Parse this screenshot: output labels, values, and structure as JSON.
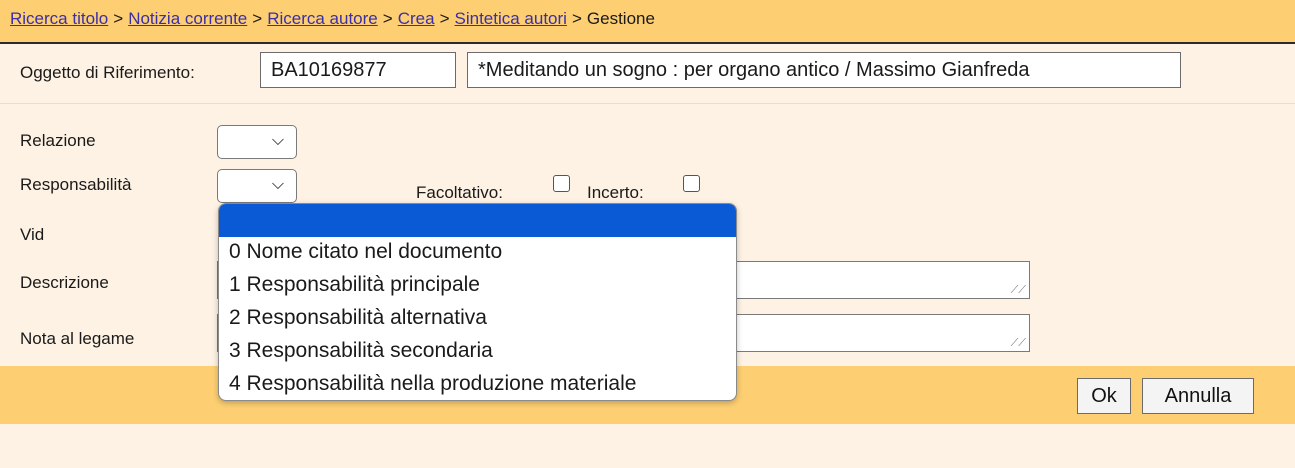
{
  "breadcrumb": {
    "links": [
      "Ricerca titolo",
      "Notizia corrente",
      "Ricerca autore",
      "Crea",
      "Sintetica autori"
    ],
    "separator": ">",
    "current": "Gestione"
  },
  "reference": {
    "label": "Oggetto di Riferimento:",
    "id_value": "BA10169877",
    "title_value": "*Meditando un sogno : per organo antico / Massimo Gianfreda"
  },
  "form": {
    "relazione_label": "Relazione",
    "responsabilita_label": "Responsabilità",
    "vid_label": "Vid",
    "descrizione_label": "Descrizione",
    "nota_label": "Nota al legame",
    "facoltativo_label": "Facoltativo:",
    "incerto_label": "Incerto:"
  },
  "dropdown": {
    "selected_highlight": "",
    "options": [
      "0 Nome citato nel documento",
      "1 Responsabilità principale",
      "2 Responsabilità alternativa",
      "3 Responsabilità secondaria",
      "4 Responsabilità nella produzione materiale"
    ]
  },
  "buttons": {
    "ok": "Ok",
    "cancel": "Annulla"
  },
  "colors": {
    "header_bg": "#fdcf72",
    "page_bg": "#fdf2e4",
    "link": "#3b2fa6",
    "dropdown_highlight": "#0a5ad6"
  }
}
